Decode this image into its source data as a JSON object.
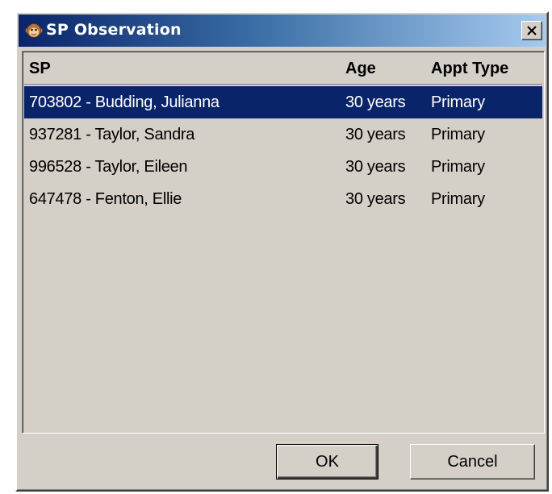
{
  "window": {
    "title": "SP Observation",
    "icon": "monkey-face-icon",
    "close_icon": "close-icon"
  },
  "list": {
    "columns": [
      "SP",
      "Age",
      "Appt Type"
    ],
    "rows": [
      {
        "sp": "703802 - Budding, Julianna",
        "age": "30 years",
        "appt_type": "Primary",
        "selected": true
      },
      {
        "sp": "937281 - Taylor, Sandra",
        "age": "30 years",
        "appt_type": "Primary",
        "selected": false
      },
      {
        "sp": "996528 - Taylor, Eileen",
        "age": "30 years",
        "appt_type": "Primary",
        "selected": false
      },
      {
        "sp": "647478 - Fenton, Ellie",
        "age": "30 years",
        "appt_type": "Primary",
        "selected": false
      }
    ]
  },
  "buttons": {
    "ok_label": "OK",
    "cancel_label": "Cancel"
  },
  "colors": {
    "title_gradient_start": "#0a246a",
    "title_gradient_end": "#a6caf0",
    "selection": "#0a246a",
    "face": "#d4d0c8"
  }
}
